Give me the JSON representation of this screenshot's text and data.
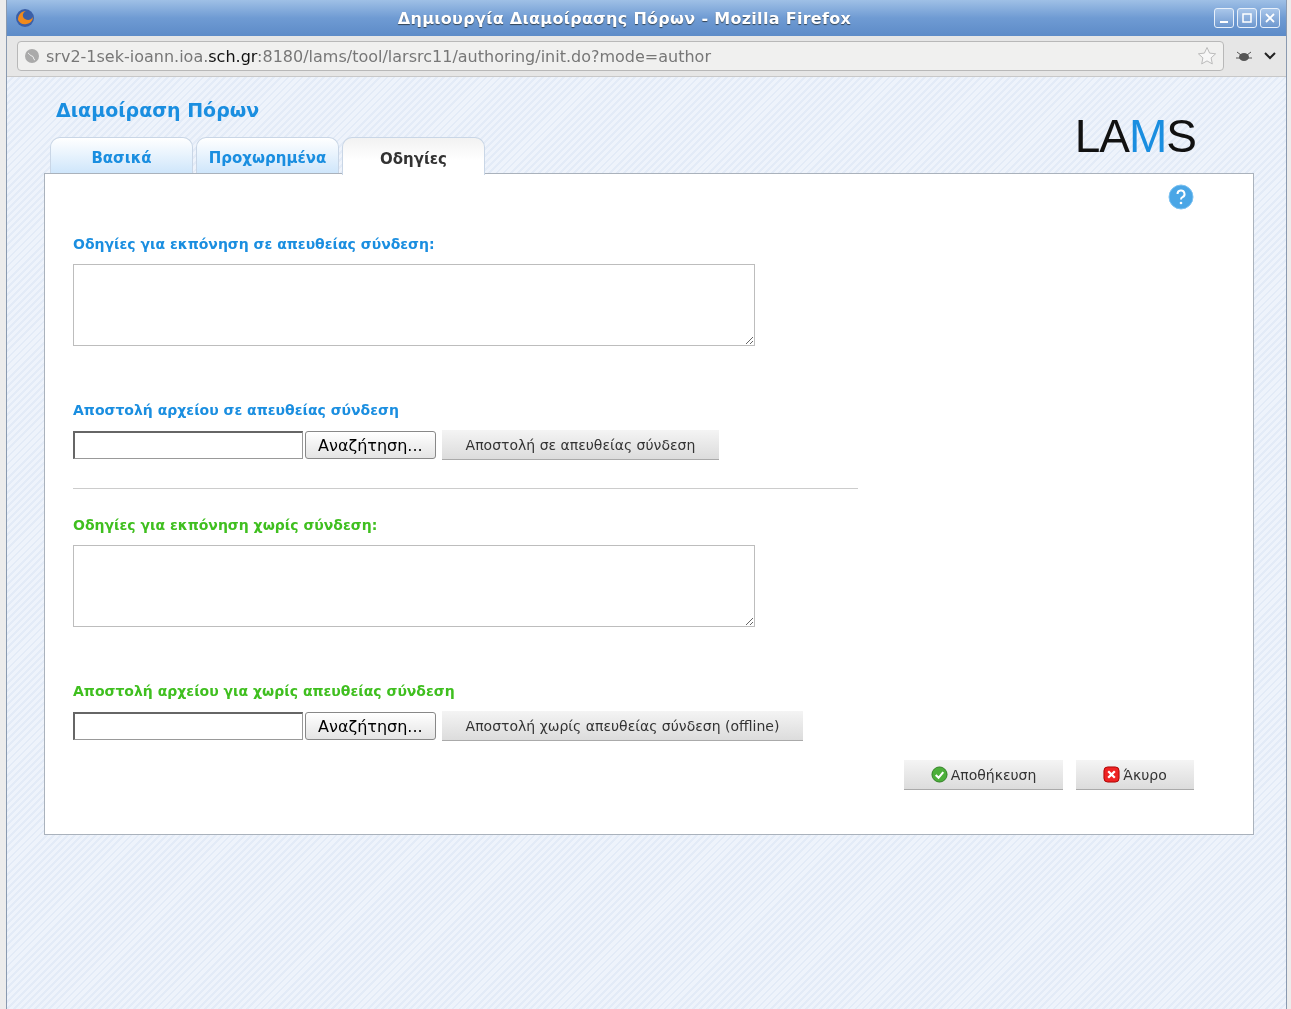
{
  "window": {
    "title": "Δημιουργία Διαμοίρασης Πόρων - Mozilla Firefox"
  },
  "address_bar": {
    "url": "srv2-1sek-ioann.ioa.**sch.gr**:8180/lams/tool/larsrc11/authoring/init.do?mode=author"
  },
  "page": {
    "heading": "Διαμοίραση Πόρων",
    "logo": "LAMS"
  },
  "tabs": [
    {
      "label": "Βασικά",
      "selected": false
    },
    {
      "label": "Προχωρημένα",
      "selected": false
    },
    {
      "label": "Οδηγίες",
      "selected": true
    }
  ],
  "sections": [
    {
      "color": "#1a8ee0",
      "instructions_label": "Οδηγίες για εκπόνηση σε απευθείας σύνδεση:",
      "upload_label": "Αποστολή αρχείου σε απευθείας σύνδεση",
      "browse_button": "Αναζήτηση...",
      "upload_button": "Αποστολή σε απευθείας σύνδεση"
    },
    {
      "color": "#3fbf1f",
      "instructions_label": "Οδηγίες για εκπόνηση χωρίς σύνδεση:",
      "upload_label": "Αποστολή αρχείου για χωρίς απευθείας σύνδεση",
      "browse_button": "Αναζήτηση...",
      "upload_button": "Αποστολή χωρίς απευθείας σύνδεση (offline)"
    }
  ],
  "buttons": [
    {
      "kind": "save",
      "label": "Αποθήκευση"
    },
    {
      "kind": "cancel",
      "label": "Άκυρο"
    }
  ]
}
